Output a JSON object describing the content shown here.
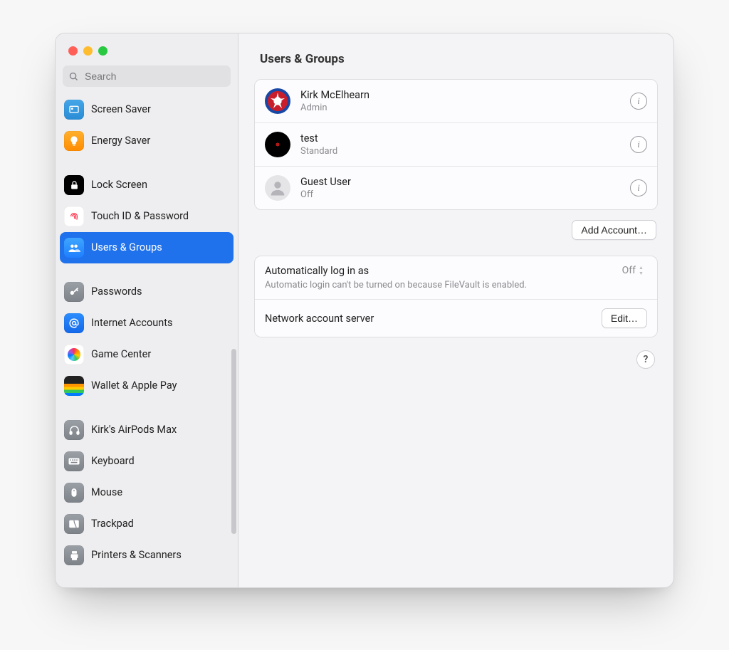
{
  "header": {
    "title": "Users & Groups"
  },
  "search": {
    "placeholder": "Search"
  },
  "sidebar": {
    "items": [
      {
        "label": "Screen Saver"
      },
      {
        "label": "Energy Saver"
      },
      {
        "label": "Lock Screen"
      },
      {
        "label": "Touch ID & Password"
      },
      {
        "label": "Users & Groups"
      },
      {
        "label": "Passwords"
      },
      {
        "label": "Internet Accounts"
      },
      {
        "label": "Game Center"
      },
      {
        "label": "Wallet & Apple Pay"
      },
      {
        "label": "Kirk's AirPods Max"
      },
      {
        "label": "Keyboard"
      },
      {
        "label": "Mouse"
      },
      {
        "label": "Trackpad"
      },
      {
        "label": "Printers & Scanners"
      }
    ]
  },
  "users": [
    {
      "name": "Kirk McElhearn",
      "role": "Admin"
    },
    {
      "name": "test",
      "role": "Standard"
    },
    {
      "name": "Guest User",
      "role": "Off"
    }
  ],
  "buttons": {
    "add_account": "Add Account…",
    "edit": "Edit…",
    "help": "?"
  },
  "auto_login": {
    "title": "Automatically log in as",
    "value": "Off",
    "desc": "Automatic login can't be turned on because FileVault is enabled."
  },
  "network_server": {
    "title": "Network account server"
  }
}
